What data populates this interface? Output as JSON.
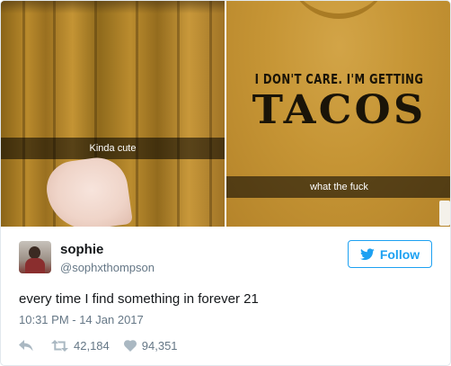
{
  "photos": {
    "left_caption": "Kinda cute",
    "right_caption": "what the fuck",
    "shirt_text_line1": "I DON'T CARE. I'M GETTING",
    "shirt_text_line2": "TACOS"
  },
  "tweet": {
    "name": "sophie",
    "handle": "@sophxthompson",
    "follow_label": "Follow",
    "text": "every time I find something in forever 21",
    "timestamp": "10:31 PM - 14 Jan 2017",
    "retweets": "42,184",
    "likes": "94,351"
  },
  "colors": {
    "accent": "#1da1f2",
    "muted": "#657786",
    "icon": "#aab8c2",
    "mustard": "#c69535"
  },
  "icons": {
    "follow": "twitter-bird-icon",
    "reply": "reply-arrow-icon",
    "retweet": "retweet-icon",
    "like": "heart-icon"
  }
}
